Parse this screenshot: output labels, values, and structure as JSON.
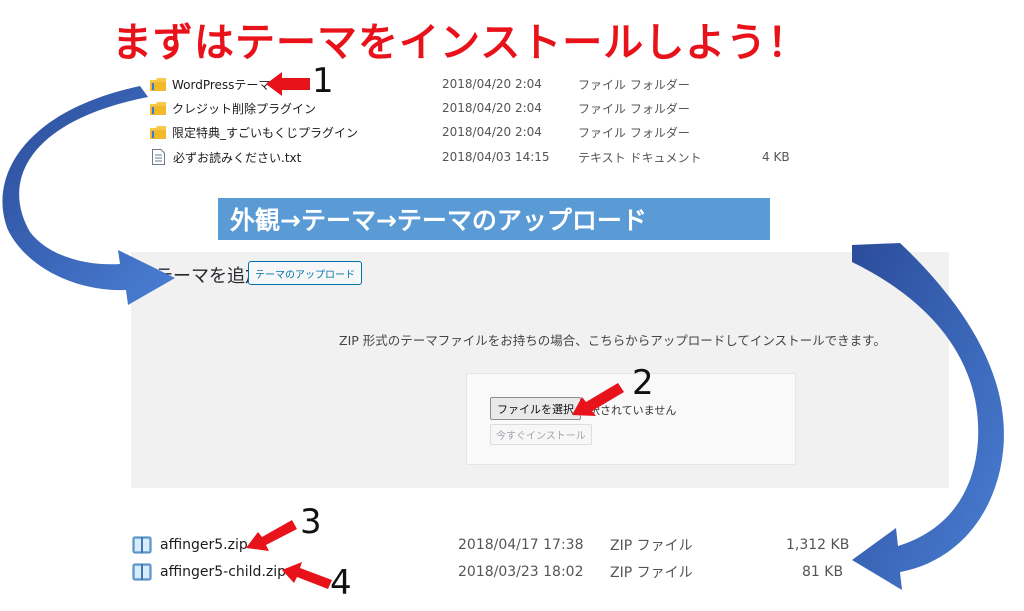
{
  "headline": "まずはテーマをインストールしよう！",
  "files_top": [
    {
      "name": "WordPressテーマ",
      "date": "2018/04/20 2:04",
      "type": "ファイル フォルダー",
      "size": "",
      "icon": "folder-icon"
    },
    {
      "name": "クレジット削除プラグイン",
      "date": "2018/04/20 2:04",
      "type": "ファイル フォルダー",
      "size": "",
      "icon": "folder-icon"
    },
    {
      "name": "限定特典_すごいもくじプラグイン",
      "date": "2018/04/20 2:04",
      "type": "ファイル フォルダー",
      "size": "",
      "icon": "folder-icon"
    },
    {
      "name": "必ずお読みください.txt",
      "date": "2018/04/03 14:15",
      "type": "テキスト ドキュメント",
      "size": "4 KB",
      "icon": "text-document-icon"
    }
  ],
  "banner": "外観→テーマ→テーマのアップロード",
  "wp": {
    "title": "テーマを追加",
    "upload_theme_button": "テーマのアップロード",
    "description": "ZIP 形式のテーマファイルをお持ちの場合、こちらからアップロードしてインストールできます。",
    "choose_file_button": "ファイルを選択",
    "no_file_text": "選択されていません",
    "install_now_button": "今すぐインストール"
  },
  "files_bottom": [
    {
      "name": "affinger5.zip",
      "date": "2018/04/17 17:38",
      "type": "ZIP ファイル",
      "size": "1,312 KB",
      "icon": "zip-archive-icon"
    },
    {
      "name": "affinger5-child.zip",
      "date": "2018/03/23 18:02",
      "type": "ZIP ファイル",
      "size": "81 KB",
      "icon": "zip-archive-icon"
    }
  ],
  "steps": [
    "1",
    "2",
    "3",
    "4"
  ],
  "colors": {
    "headline": "#e8121b",
    "banner": "#5b9bd5",
    "pointer_arrow": "#e8121b",
    "curved_arrow": "#3a62b8"
  }
}
